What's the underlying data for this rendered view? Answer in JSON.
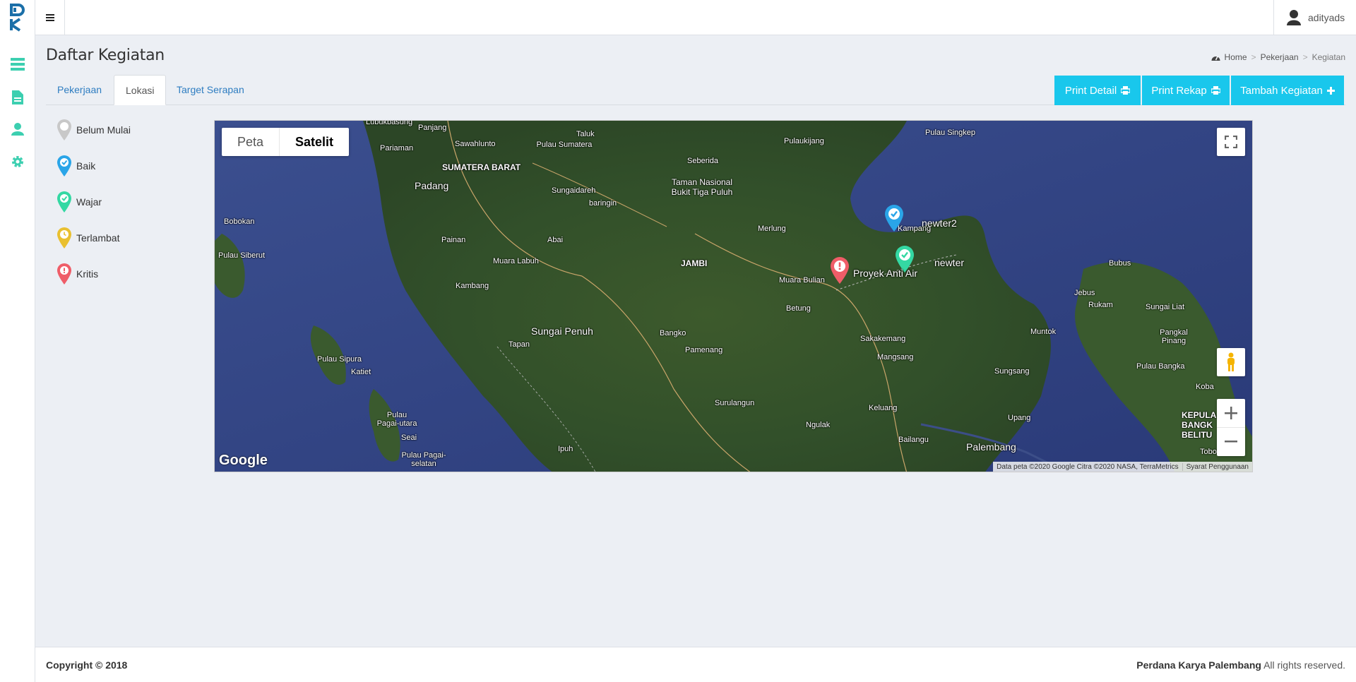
{
  "topbar": {
    "username": "adityads"
  },
  "page": {
    "title": "Daftar Kegiatan"
  },
  "breadcrumb": {
    "home": "Home",
    "parent": "Pekerjaan",
    "current": "Kegiatan"
  },
  "tabs": [
    "Pekerjaan",
    "Lokasi",
    "Target Serapan"
  ],
  "buttons": {
    "print_detail": "Print Detail",
    "print_rekap": "Print Rekap",
    "tambah": "Tambah Kegiatan"
  },
  "legend": [
    {
      "label": "Belum Mulai",
      "color": "#c8c8c8",
      "icon": "pin-gray-icon"
    },
    {
      "label": "Baik",
      "color": "#2aa5e8",
      "icon": "pin-check-blue-icon"
    },
    {
      "label": "Wajar",
      "color": "#34d8a3",
      "icon": "pin-check-green-icon"
    },
    {
      "label": "Terlambat",
      "color": "#e9c030",
      "icon": "pin-clock-yellow-icon"
    },
    {
      "label": "Kritis",
      "color": "#ef5d68",
      "icon": "pin-alert-red-icon"
    }
  ],
  "map": {
    "type_map": "Peta",
    "type_satellite": "Satelit",
    "places": [
      "Lubukbasung",
      "Panjang",
      "Pariaman",
      "Sawahlunto",
      "Pulau Sumatera",
      "Taluk",
      "Pulaukijang",
      "Pulau Singkep",
      "SUMATERA BARAT",
      "Padang",
      "Seberida",
      "Sungaidareh",
      "Taman Nasional Bukit Tiga Puluh",
      "baringin",
      "Bobokan",
      "Merlung",
      "Pulau Siberut",
      "Painan",
      "Abai",
      "Muara Labuh",
      "JAMBI",
      "Muara Bulian",
      "Kambang",
      "Betung",
      "Sungai Penuh",
      "Bangko",
      "Tapan",
      "Pamenang",
      "Sakakemang",
      "Mangsang",
      "Pulau Sipura",
      "Katiet",
      "Surulangun",
      "Keluang",
      "Ngulak",
      "Bailangu",
      "Pulau Pagai-utara",
      "Seai",
      "Pulau Pagai-selatan",
      "Ipuh",
      "Palembang",
      "Upang",
      "Sungsang",
      "Muntok",
      "Bubus",
      "Jebus",
      "Rukam",
      "Sungai Liat",
      "Pangkal Pinang",
      "Pulau Bangka",
      "Koba",
      "KEPULA BANGK BELITU",
      "Toboali",
      "Kampang"
    ],
    "markers": [
      {
        "label": "newter2",
        "status": "Baik",
        "color": "#2aa5e8"
      },
      {
        "label": "Proyek Anti Air",
        "status": "Wajar",
        "color": "#34d8a3"
      },
      {
        "label": "newter",
        "status": "Kritis",
        "color": "#ef5d68"
      }
    ],
    "attribution": "Data peta ©2020 Google Citra ©2020 NASA, TerraMetrics",
    "terms": "Syarat Penggunaan",
    "google": "Google"
  },
  "footer": {
    "copyright": "Copyright © 2018",
    "company": "Perdana Karya Palembang",
    "rights": "All rights reserved."
  }
}
